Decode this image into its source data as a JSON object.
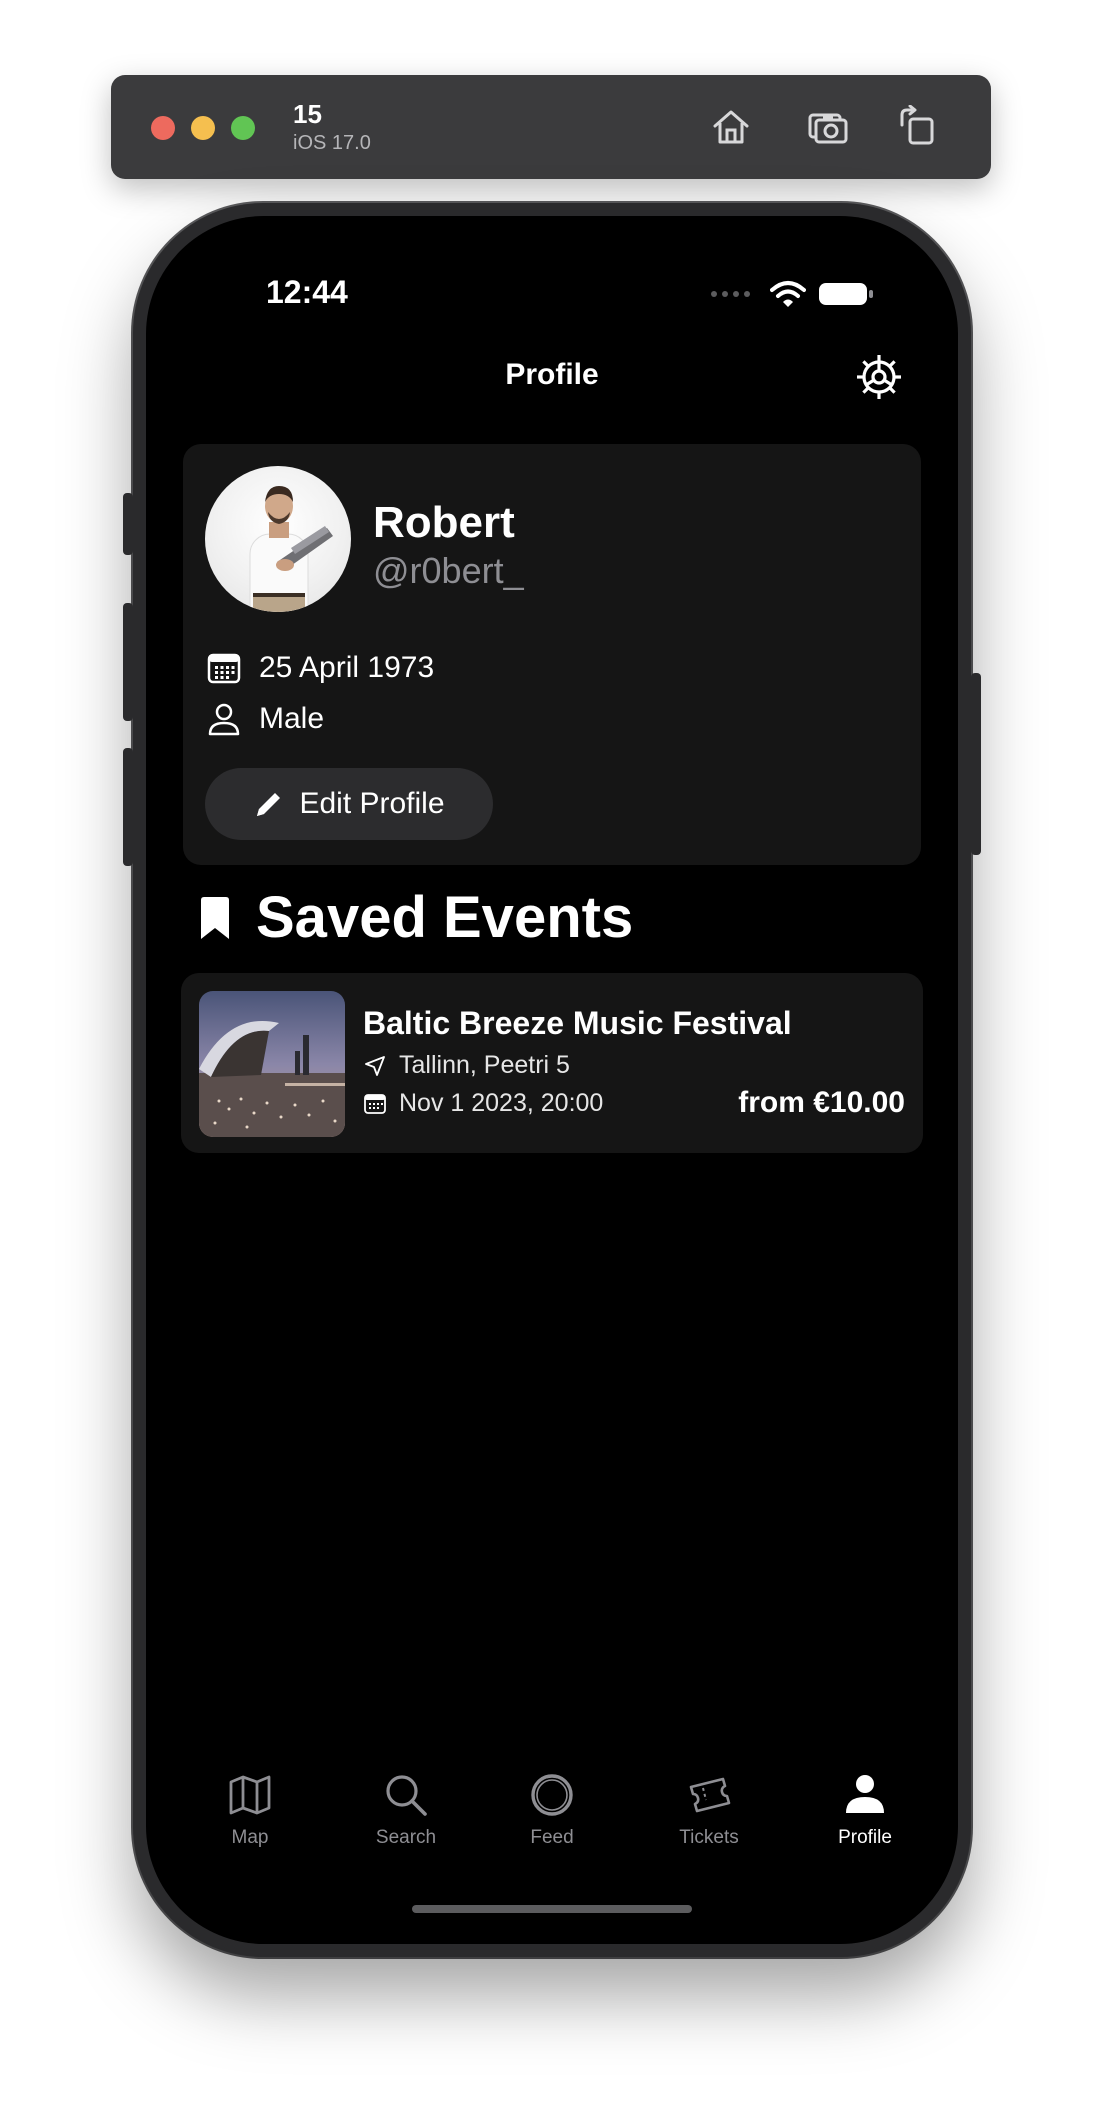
{
  "simulator": {
    "device_name": "15",
    "os_version": "iOS 17.0"
  },
  "status_bar": {
    "time": "12:44"
  },
  "nav": {
    "title": "Profile"
  },
  "profile": {
    "name": "Robert",
    "handle": "@r0bert_",
    "birthdate": "25 April 1973",
    "gender": "Male",
    "edit_label": "Edit Profile"
  },
  "saved_events": {
    "title": "Saved Events",
    "items": [
      {
        "title": "Baltic Breeze Music Festival",
        "location": "Tallinn, Peetri 5",
        "datetime": "Nov 1 2023, 20:00",
        "price": "from €10.00"
      }
    ]
  },
  "tabbar": {
    "items": [
      {
        "label": "Map",
        "icon": "map-icon"
      },
      {
        "label": "Search",
        "icon": "search-icon"
      },
      {
        "label": "Feed",
        "icon": "feed-icon"
      },
      {
        "label": "Tickets",
        "icon": "tickets-icon"
      },
      {
        "label": "Profile",
        "icon": "person-icon"
      }
    ],
    "active": "Profile"
  },
  "colors": {
    "background": "#000000",
    "card": "#151515",
    "secondary_text": "#8e8e93",
    "button": "#2c2c2e"
  }
}
